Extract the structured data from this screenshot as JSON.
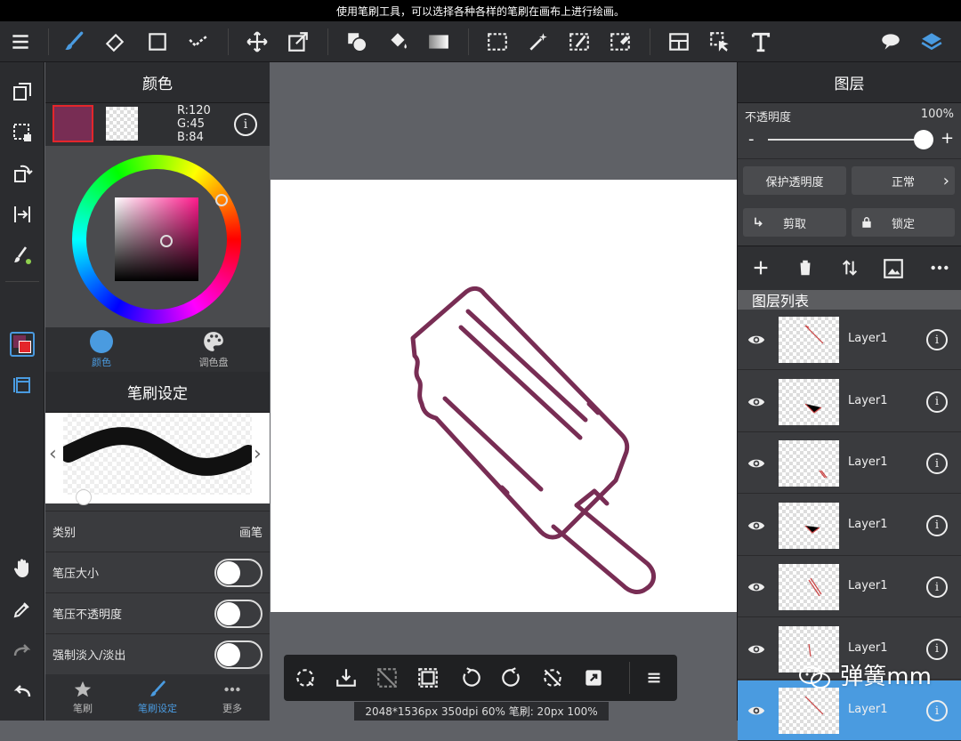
{
  "hint": "使用笔刷工具，可以选择各种各样的笔刷在画布上进行绘画。",
  "color_panel": {
    "title": "颜色",
    "primary_color": "#782d54",
    "rgb_r": "R:120",
    "rgb_g": "G:45",
    "rgb_b": "B:84",
    "tab_color": "颜色",
    "tab_palette": "调色盘"
  },
  "brush_panel": {
    "title": "笔刷设定",
    "category_label": "类别",
    "category_value": "画笔",
    "pressure_size": "笔压大小",
    "pressure_opacity": "笔压不透明度",
    "force_fade": "强制淡入/淡出",
    "tab_brush": "笔刷",
    "tab_brush_settings": "笔刷设定",
    "tab_more": "更多"
  },
  "layer_panel": {
    "title": "图层",
    "opacity_label": "不透明度",
    "opacity_value": "100%",
    "protect_alpha": "保护透明度",
    "blend_mode": "正常",
    "clip": "剪取",
    "lock": "锁定",
    "list_title": "图层列表",
    "layers": [
      {
        "name": "Layer1"
      },
      {
        "name": "Layer1"
      },
      {
        "name": "Layer1"
      },
      {
        "name": "Layer1"
      },
      {
        "name": "Layer1"
      },
      {
        "name": "Layer1"
      },
      {
        "name": "Layer1"
      }
    ]
  },
  "status": "2048*1536px 350dpi 60% 笔刷: 20px 100%",
  "watermark": "弹簧mm",
  "accent_color": "#4a9be0"
}
